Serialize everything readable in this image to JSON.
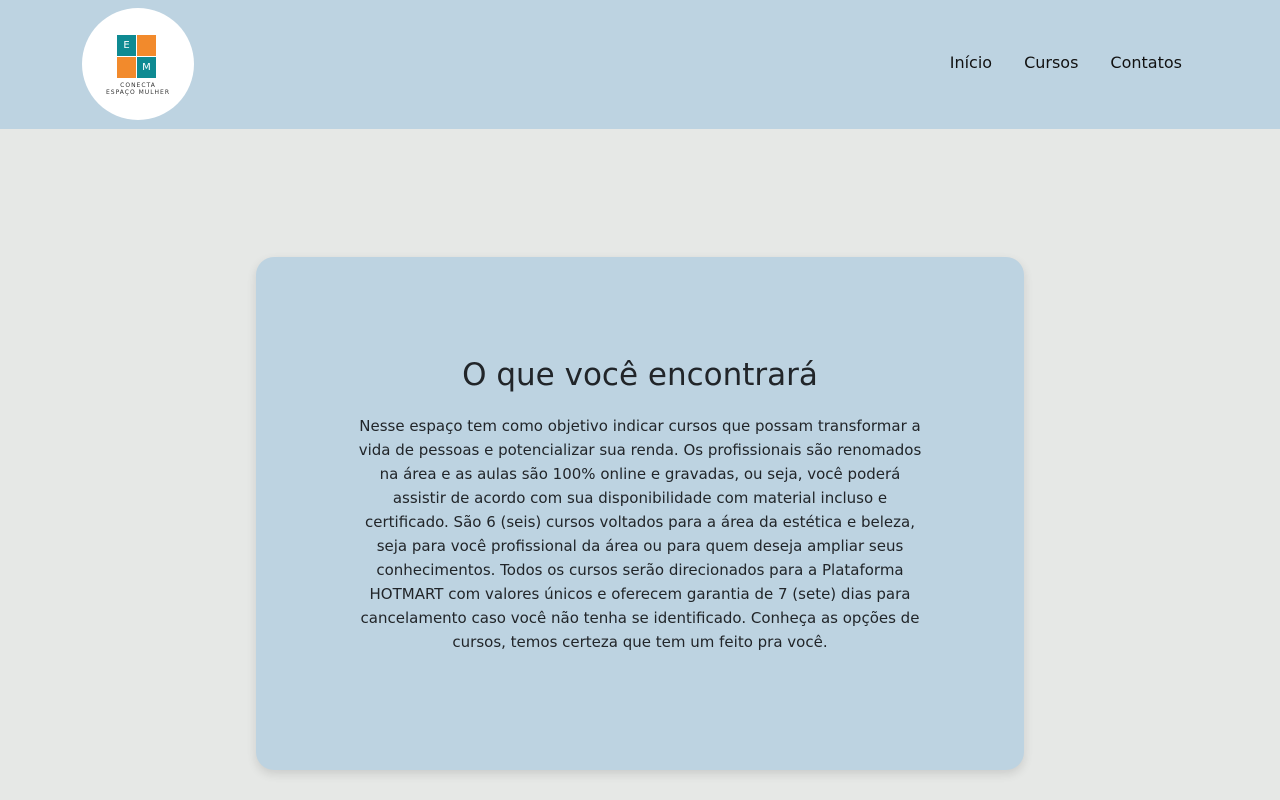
{
  "header": {
    "logo": {
      "letters": [
        "E",
        "M"
      ],
      "text_line1": "CONECTA",
      "text_line2": "ESPAÇO MULHER"
    },
    "nav": [
      {
        "label": "Início"
      },
      {
        "label": "Cursos"
      },
      {
        "label": "Contatos"
      }
    ]
  },
  "main": {
    "title": "O que você encontrará",
    "body": "Nesse espaço tem como objetivo indicar cursos que possam transformar a vida de pessoas e potencializar sua renda. Os profissionais são renomados na área e as aulas são 100% online e gravadas, ou seja, você poderá assistir de acordo com sua disponibilidade com material incluso e certificado. São 6 (seis) cursos voltados para a área da estética e beleza, seja para você profissional da área ou para quem deseja ampliar seus conhecimentos. Todos os cursos serão direcionados para a Plataforma HOTMART com valores únicos e oferecem garantia de 7 (sete) dias para cancelamento caso você não tenha se identificado. Conheça as opções de cursos, temos certeza que tem um feito pra você."
  },
  "colors": {
    "header_bg": "#bdd3e1",
    "page_bg": "#e6e8e6",
    "card_bg": "#bdd3e1",
    "logo_teal": "#0e8a92",
    "logo_orange": "#f28a2c"
  }
}
